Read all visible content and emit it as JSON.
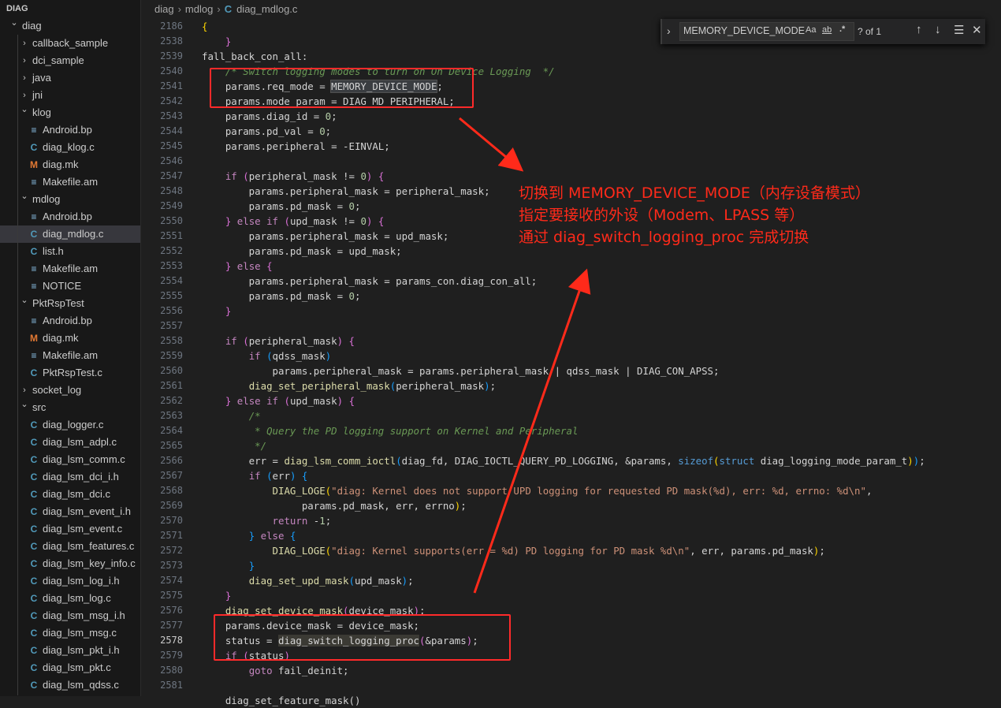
{
  "sidebar": {
    "header": "DIAG",
    "items": [
      {
        "label": "diag",
        "type": "folder-open",
        "depth": 0
      },
      {
        "label": "callback_sample",
        "type": "folder",
        "depth": 1
      },
      {
        "label": "dci_sample",
        "type": "folder",
        "depth": 1
      },
      {
        "label": "java",
        "type": "folder",
        "depth": 1
      },
      {
        "label": "jni",
        "type": "folder",
        "depth": 1
      },
      {
        "label": "klog",
        "type": "folder-open",
        "depth": 1
      },
      {
        "label": "Android.bp",
        "type": "file-lines",
        "depth": 2
      },
      {
        "label": "diag_klog.c",
        "type": "file-c",
        "depth": 2
      },
      {
        "label": "diag.mk",
        "type": "file-mk",
        "depth": 2
      },
      {
        "label": "Makefile.am",
        "type": "file-lines",
        "depth": 2
      },
      {
        "label": "mdlog",
        "type": "folder-open",
        "depth": 1
      },
      {
        "label": "Android.bp",
        "type": "file-lines",
        "depth": 2
      },
      {
        "label": "diag_mdlog.c",
        "type": "file-c",
        "depth": 2,
        "selected": true
      },
      {
        "label": "list.h",
        "type": "file-c",
        "depth": 2
      },
      {
        "label": "Makefile.am",
        "type": "file-lines",
        "depth": 2
      },
      {
        "label": "NOTICE",
        "type": "file-lines",
        "depth": 2
      },
      {
        "label": "PktRspTest",
        "type": "folder-open",
        "depth": 1
      },
      {
        "label": "Android.bp",
        "type": "file-lines",
        "depth": 2
      },
      {
        "label": "diag.mk",
        "type": "file-mk",
        "depth": 2
      },
      {
        "label": "Makefile.am",
        "type": "file-lines",
        "depth": 2
      },
      {
        "label": "PktRspTest.c",
        "type": "file-c",
        "depth": 2
      },
      {
        "label": "socket_log",
        "type": "folder",
        "depth": 1
      },
      {
        "label": "src",
        "type": "folder-open",
        "depth": 1
      },
      {
        "label": "diag_logger.c",
        "type": "file-c",
        "depth": 2
      },
      {
        "label": "diag_lsm_adpl.c",
        "type": "file-c",
        "depth": 2
      },
      {
        "label": "diag_lsm_comm.c",
        "type": "file-c",
        "depth": 2
      },
      {
        "label": "diag_lsm_dci_i.h",
        "type": "file-c",
        "depth": 2
      },
      {
        "label": "diag_lsm_dci.c",
        "type": "file-c",
        "depth": 2
      },
      {
        "label": "diag_lsm_event_i.h",
        "type": "file-c",
        "depth": 2
      },
      {
        "label": "diag_lsm_event.c",
        "type": "file-c",
        "depth": 2
      },
      {
        "label": "diag_lsm_features.c",
        "type": "file-c",
        "depth": 2
      },
      {
        "label": "diag_lsm_key_info.c",
        "type": "file-c",
        "depth": 2
      },
      {
        "label": "diag_lsm_log_i.h",
        "type": "file-c",
        "depth": 2
      },
      {
        "label": "diag_lsm_log.c",
        "type": "file-c",
        "depth": 2
      },
      {
        "label": "diag_lsm_msg_i.h",
        "type": "file-c",
        "depth": 2
      },
      {
        "label": "diag_lsm_msg.c",
        "type": "file-c",
        "depth": 2
      },
      {
        "label": "diag_lsm_pkt_i.h",
        "type": "file-c",
        "depth": 2
      },
      {
        "label": "diag_lsm_pkt.c",
        "type": "file-c",
        "depth": 2
      },
      {
        "label": "diag_lsm_qdss.c",
        "type": "file-c",
        "depth": 2
      }
    ],
    "icon_colors": {
      "file-c": "#519aba",
      "file-mk": "#e37933",
      "file-lines": "#8dc3e9",
      "folder": "#c5c5c5"
    }
  },
  "breadcrumb": {
    "parts": [
      "diag",
      "mdlog",
      "diag_mdlog.c"
    ],
    "file_icon": "C"
  },
  "find": {
    "value": "MEMORY_DEVICE_MODE",
    "match_case": "Aa",
    "whole_word": "ab",
    "regex": ".*",
    "count": "? of 1",
    "prev_icon": "arrow-up-icon",
    "next_icon": "arrow-down-icon",
    "selection_icon": "find-in-selection-icon",
    "close_icon": "close-icon"
  },
  "editor": {
    "line_numbers": [
      "2186",
      "2538",
      "2539",
      "2540",
      "2541",
      "2542",
      "2543",
      "2544",
      "2545",
      "2546",
      "2547",
      "2548",
      "2549",
      "2550",
      "2551",
      "2552",
      "2553",
      "2554",
      "2555",
      "2556",
      "2557",
      "2558",
      "2559",
      "2560",
      "2561",
      "2562",
      "2563",
      "2564",
      "2565",
      "2566",
      "2567",
      "2568",
      "2569",
      "2570",
      "2571",
      "2572",
      "2573",
      "2574",
      "2575",
      "2576",
      "2577",
      "2578",
      "2579",
      "2580",
      "2581"
    ],
    "active_line": "2578",
    "lines": [
      [
        [
          "br1",
          "{"
        ]
      ],
      [
        [
          "id",
          "    "
        ],
        [
          "br2",
          "}"
        ]
      ],
      [
        [
          "id",
          "fall_back_con_all:"
        ]
      ],
      [
        [
          "id",
          "    "
        ],
        [
          "cm",
          "/* Switch logging modes to turn on On Device Logging  */"
        ]
      ],
      [
        [
          "id",
          "    params.req_mode = "
        ],
        [
          "hl",
          "MEMORY_DEVICE_MODE"
        ],
        [
          "id",
          ";"
        ]
      ],
      [
        [
          "id",
          "    params.mode_param = DIAG_MD_PERIPHERAL;"
        ]
      ],
      [
        [
          "id",
          "    params.diag_id = "
        ],
        [
          "num",
          "0"
        ],
        [
          "id",
          ";"
        ]
      ],
      [
        [
          "id",
          "    params.pd_val = "
        ],
        [
          "num",
          "0"
        ],
        [
          "id",
          ";"
        ]
      ],
      [
        [
          "id",
          "    params.peripheral = -EINVAL;"
        ]
      ],
      [
        [
          "id",
          ""
        ]
      ],
      [
        [
          "id",
          "    "
        ],
        [
          "ctl",
          "if"
        ],
        [
          "id",
          " "
        ],
        [
          "br2",
          "("
        ],
        [
          "id",
          "peripheral_mask != "
        ],
        [
          "num",
          "0"
        ],
        [
          "br2",
          ")"
        ],
        [
          "id",
          " "
        ],
        [
          "br2",
          "{"
        ]
      ],
      [
        [
          "id",
          "        params.peripheral_mask = peripheral_mask;"
        ]
      ],
      [
        [
          "id",
          "        params.pd_mask = "
        ],
        [
          "num",
          "0"
        ],
        [
          "id",
          ";"
        ]
      ],
      [
        [
          "id",
          "    "
        ],
        [
          "br2",
          "}"
        ],
        [
          "id",
          " "
        ],
        [
          "ctl",
          "else if"
        ],
        [
          "id",
          " "
        ],
        [
          "br2",
          "("
        ],
        [
          "id",
          "upd_mask != "
        ],
        [
          "num",
          "0"
        ],
        [
          "br2",
          ")"
        ],
        [
          "id",
          " "
        ],
        [
          "br2",
          "{"
        ]
      ],
      [
        [
          "id",
          "        params.peripheral_mask = upd_mask;"
        ]
      ],
      [
        [
          "id",
          "        params.pd_mask = upd_mask;"
        ]
      ],
      [
        [
          "id",
          "    "
        ],
        [
          "br2",
          "}"
        ],
        [
          "id",
          " "
        ],
        [
          "ctl",
          "else"
        ],
        [
          "id",
          " "
        ],
        [
          "br2",
          "{"
        ]
      ],
      [
        [
          "id",
          "        params.peripheral_mask = params_con.diag_con_all;"
        ]
      ],
      [
        [
          "id",
          "        params.pd_mask = "
        ],
        [
          "num",
          "0"
        ],
        [
          "id",
          ";"
        ]
      ],
      [
        [
          "id",
          "    "
        ],
        [
          "br2",
          "}"
        ]
      ],
      [
        [
          "id",
          ""
        ]
      ],
      [
        [
          "id",
          "    "
        ],
        [
          "ctl",
          "if"
        ],
        [
          "id",
          " "
        ],
        [
          "br2",
          "("
        ],
        [
          "id",
          "peripheral_mask"
        ],
        [
          "br2",
          ")"
        ],
        [
          "id",
          " "
        ],
        [
          "br2",
          "{"
        ]
      ],
      [
        [
          "id",
          "        "
        ],
        [
          "ctl",
          "if"
        ],
        [
          "id",
          " "
        ],
        [
          "br3",
          "("
        ],
        [
          "id",
          "qdss_mask"
        ],
        [
          "br3",
          ")"
        ]
      ],
      [
        [
          "id",
          "            params.peripheral_mask = params.peripheral_mask | qdss_mask | DIAG_CON_APSS;"
        ]
      ],
      [
        [
          "id",
          "        "
        ],
        [
          "fn",
          "diag_set_peripheral_mask"
        ],
        [
          "br3",
          "("
        ],
        [
          "id",
          "peripheral_mask"
        ],
        [
          "br3",
          ")"
        ],
        [
          "id",
          ";"
        ]
      ],
      [
        [
          "id",
          "    "
        ],
        [
          "br2",
          "}"
        ],
        [
          "id",
          " "
        ],
        [
          "ctl",
          "else if"
        ],
        [
          "id",
          " "
        ],
        [
          "br2",
          "("
        ],
        [
          "id",
          "upd_mask"
        ],
        [
          "br2",
          ")"
        ],
        [
          "id",
          " "
        ],
        [
          "br2",
          "{"
        ]
      ],
      [
        [
          "id",
          "        "
        ],
        [
          "cm",
          "/*"
        ]
      ],
      [
        [
          "id",
          "        "
        ],
        [
          "cm",
          " * Query the PD logging support on Kernel and Peripheral"
        ]
      ],
      [
        [
          "id",
          "        "
        ],
        [
          "cm",
          " */"
        ]
      ],
      [
        [
          "id",
          "        err = "
        ],
        [
          "fn",
          "diag_lsm_comm_ioctl"
        ],
        [
          "br3",
          "("
        ],
        [
          "id",
          "diag_fd, DIAG_IOCTL_QUERY_PD_LOGGING, &params, "
        ],
        [
          "kw",
          "sizeof"
        ],
        [
          "br1",
          "("
        ],
        [
          "kw",
          "struct"
        ],
        [
          "id",
          " diag_logging_mode_param_t"
        ],
        [
          "br1",
          ")"
        ],
        [
          "br3",
          ")"
        ],
        [
          "id",
          ";"
        ]
      ],
      [
        [
          "id",
          "        "
        ],
        [
          "ctl",
          "if"
        ],
        [
          "id",
          " "
        ],
        [
          "br3",
          "("
        ],
        [
          "id",
          "err"
        ],
        [
          "br3",
          ")"
        ],
        [
          "id",
          " "
        ],
        [
          "br3",
          "{"
        ]
      ],
      [
        [
          "id",
          "            "
        ],
        [
          "fn",
          "DIAG_LOGE"
        ],
        [
          "br1",
          "("
        ],
        [
          "str",
          "\"diag: Kernel does not support UPD logging for requested PD mask(%d), err: %d, errno: %d\\n\""
        ],
        [
          "id",
          ","
        ]
      ],
      [
        [
          "id",
          "                 params.pd_mask, err, errno"
        ],
        [
          "br1",
          ")"
        ],
        [
          "id",
          ";"
        ]
      ],
      [
        [
          "id",
          "            "
        ],
        [
          "ctl",
          "return"
        ],
        [
          "id",
          " -"
        ],
        [
          "num",
          "1"
        ],
        [
          "id",
          ";"
        ]
      ],
      [
        [
          "id",
          "        "
        ],
        [
          "br3",
          "}"
        ],
        [
          "id",
          " "
        ],
        [
          "ctl",
          "else"
        ],
        [
          "id",
          " "
        ],
        [
          "br3",
          "{"
        ]
      ],
      [
        [
          "id",
          "            "
        ],
        [
          "fn",
          "DIAG_LOGE"
        ],
        [
          "br1",
          "("
        ],
        [
          "str",
          "\"diag: Kernel supports(err = %d) PD logging for PD mask %d\\n\""
        ],
        [
          "id",
          ", err, params.pd_mask"
        ],
        [
          "br1",
          ")"
        ],
        [
          "id",
          ";"
        ]
      ],
      [
        [
          "id",
          "        "
        ],
        [
          "br3",
          "}"
        ]
      ],
      [
        [
          "id",
          "        "
        ],
        [
          "fn",
          "diag_set_upd_mask"
        ],
        [
          "br3",
          "("
        ],
        [
          "id",
          "upd_mask"
        ],
        [
          "br3",
          ")"
        ],
        [
          "id",
          ";"
        ]
      ],
      [
        [
          "id",
          "    "
        ],
        [
          "br2",
          "}"
        ]
      ],
      [
        [
          "id",
          "    "
        ],
        [
          "fn",
          "diag_set_device_mask"
        ],
        [
          "br2",
          "("
        ],
        [
          "id",
          "device_mask"
        ],
        [
          "br2",
          ")"
        ],
        [
          "id",
          ";"
        ]
      ],
      [
        [
          "id",
          "    params.device_mask = device_mask;"
        ]
      ],
      [
        [
          "id",
          "    status = "
        ],
        [
          "hl2",
          "diag_switch_logging_proc"
        ],
        [
          "br2",
          "("
        ],
        [
          "id",
          "&params"
        ],
        [
          "br2",
          ")"
        ],
        [
          "id",
          ";"
        ]
      ],
      [
        [
          "id",
          "    "
        ],
        [
          "ctl",
          "if"
        ],
        [
          "id",
          " "
        ],
        [
          "br2",
          "("
        ],
        [
          "id",
          "status"
        ],
        [
          "br2",
          ")"
        ]
      ],
      [
        [
          "id",
          "        "
        ],
        [
          "ctl",
          "goto"
        ],
        [
          "id",
          " fail_deinit;"
        ]
      ],
      [
        [
          "id",
          ""
        ]
      ]
    ],
    "partial_line": "    diag_set_feature_mask()"
  },
  "annotation": {
    "lines": [
      "切换到 MEMORY_DEVICE_MODE（内存设备模式）",
      "指定要接收的外设（Modem、LPASS 等）",
      "通过 diag_switch_logging_proc 完成切换"
    ],
    "color": "#ff2a1a"
  }
}
